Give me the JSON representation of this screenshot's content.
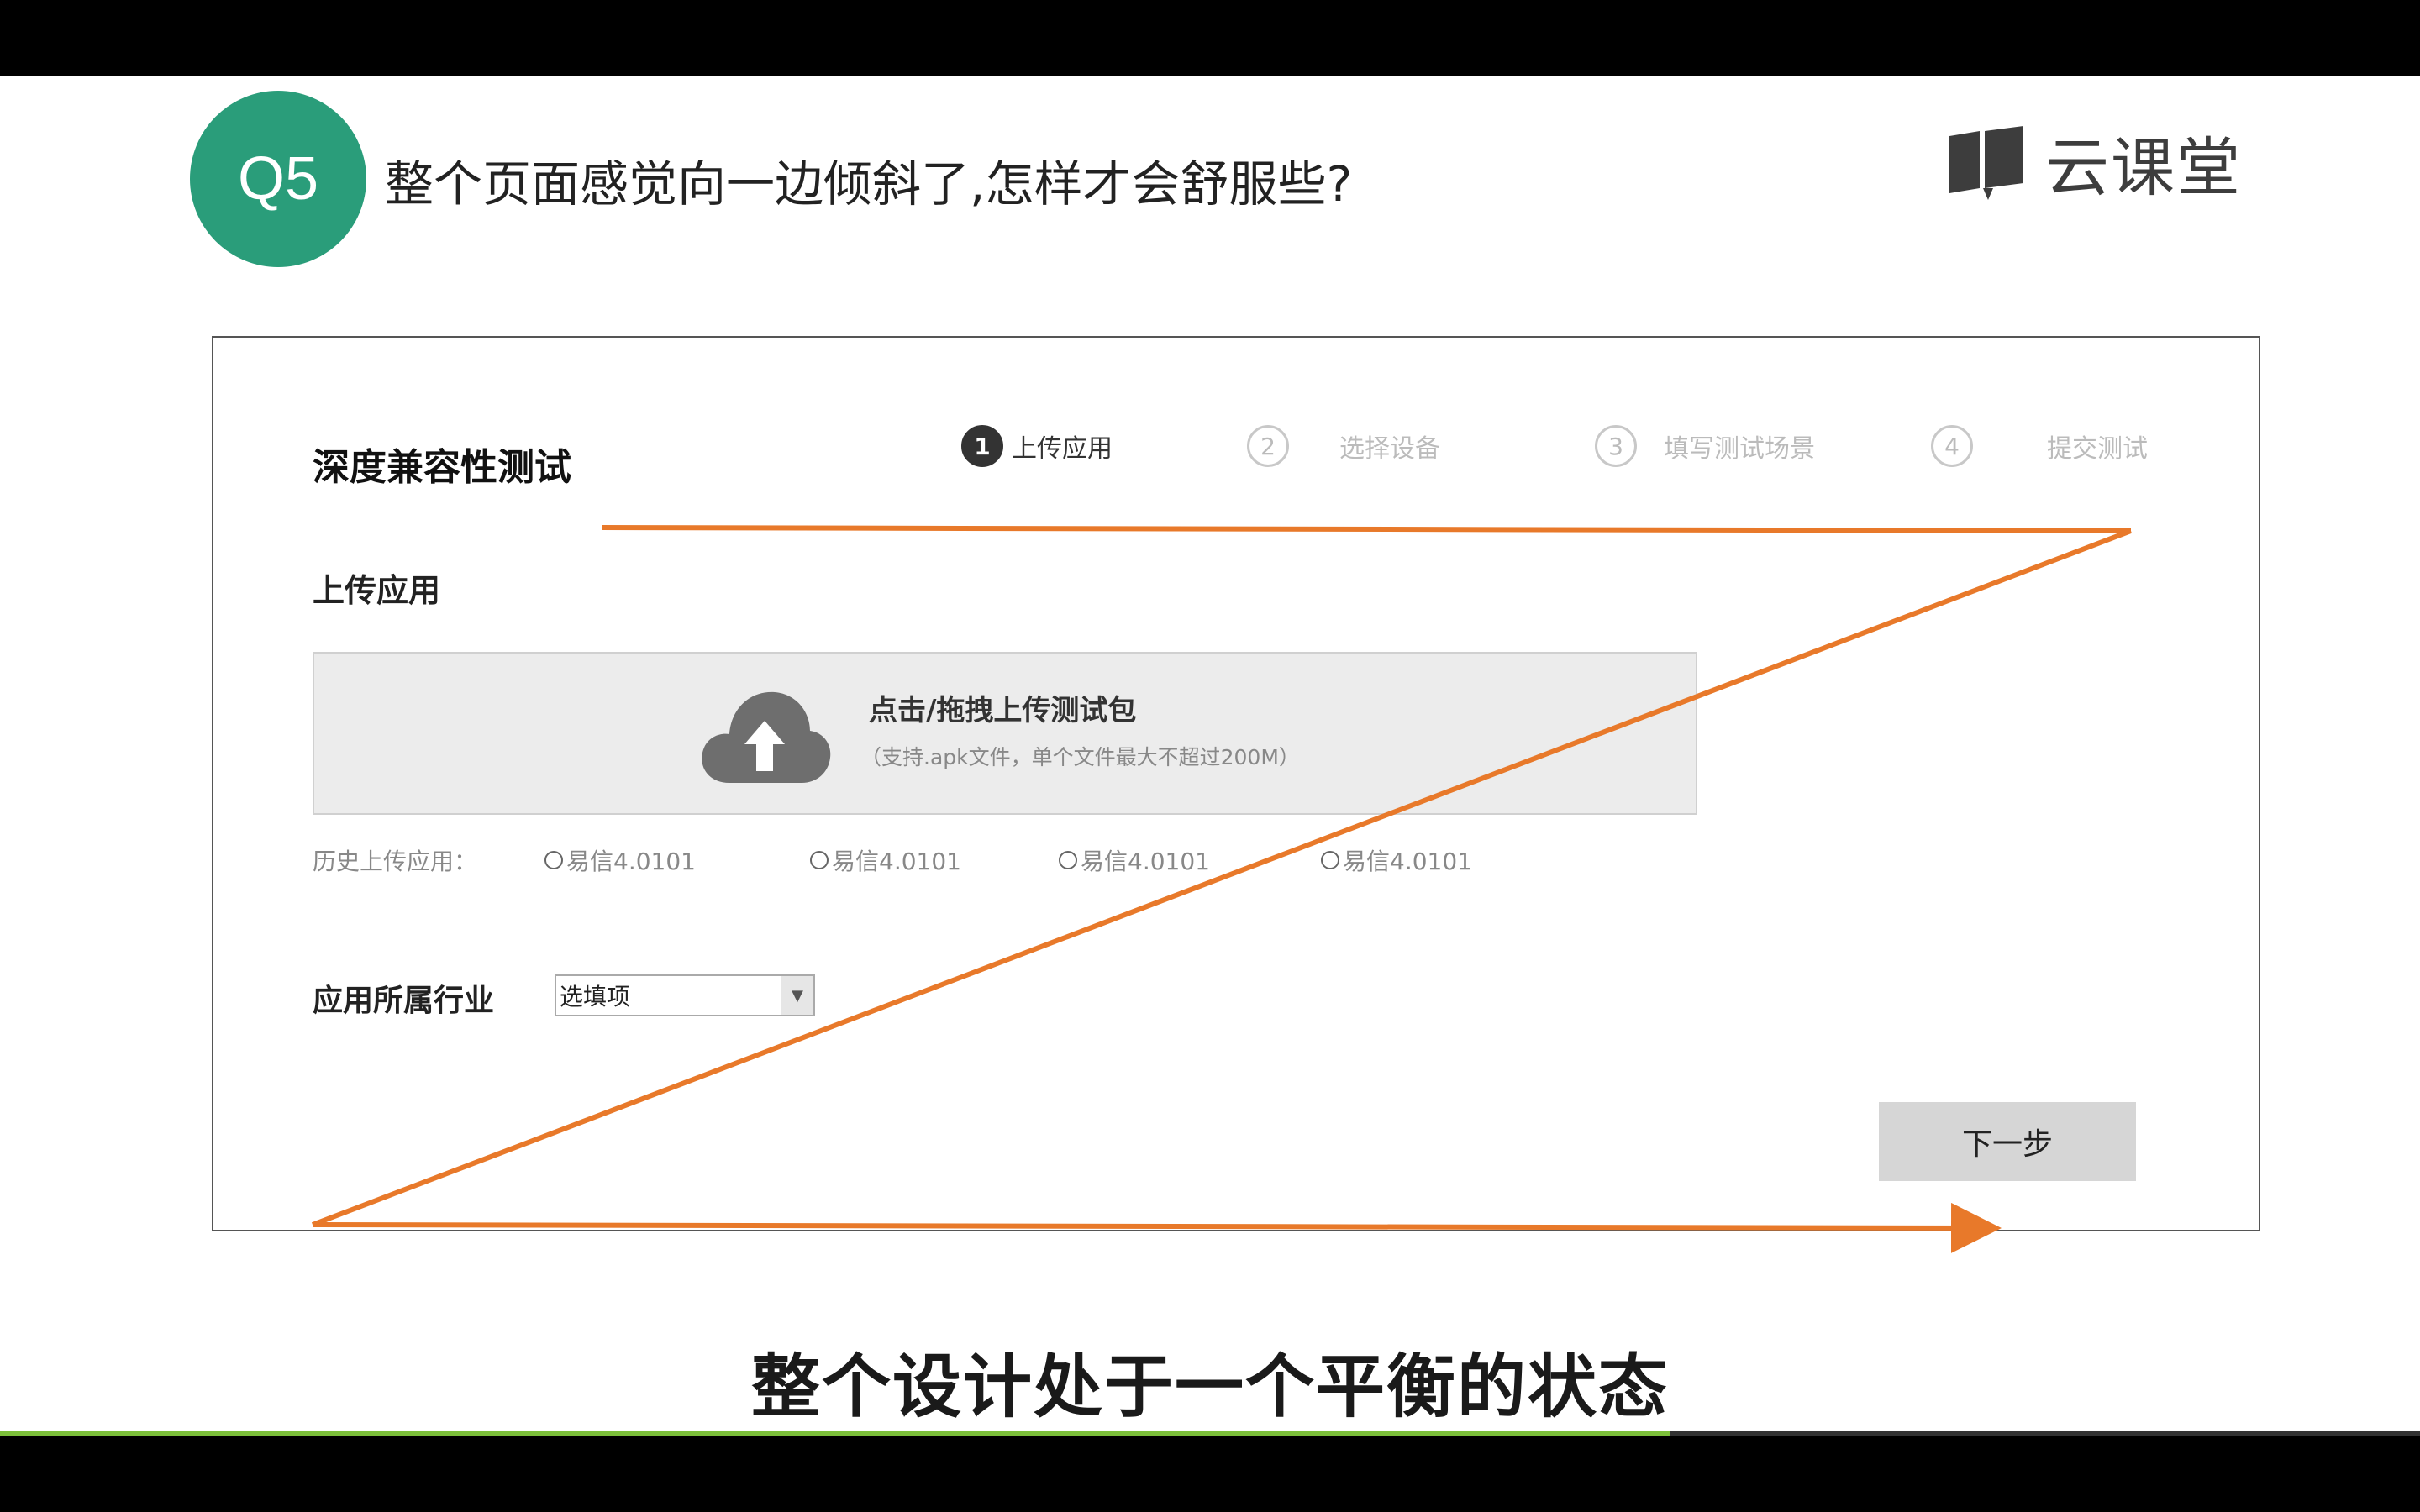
{
  "slide": {
    "badge": "Q5",
    "title": "整个页面感觉向一边倾斜了,怎样才会舒服些?",
    "logo_text": "云课堂",
    "caption": "整个设计处于一个平衡的状态"
  },
  "app": {
    "title": "深度兼容性测试",
    "steps": [
      {
        "num": "1",
        "label": "上传应用",
        "active": true
      },
      {
        "num": "2",
        "label": "选择设备",
        "active": false
      },
      {
        "num": "3",
        "label": "填写测试场景",
        "active": false
      },
      {
        "num": "4",
        "label": "提交测试",
        "active": false
      }
    ],
    "section_title": "上传应用",
    "upload": {
      "main": "点击/拖拽上传测试包",
      "sub": "（支持.apk文件，单个文件最大不超过200M）"
    },
    "history": {
      "label": "历史上传应用：",
      "options": [
        "易信4.0101",
        "易信4.0101",
        "易信4.0101",
        "易信4.0101"
      ]
    },
    "industry": {
      "label": "应用所属行业",
      "selected": "选填项"
    },
    "next_button": "下一步"
  },
  "video": {
    "progress": 0.69
  },
  "colors": {
    "badge": "#2a9d7a",
    "arrow": "#e8792a",
    "progress": "#7cbf3a"
  }
}
